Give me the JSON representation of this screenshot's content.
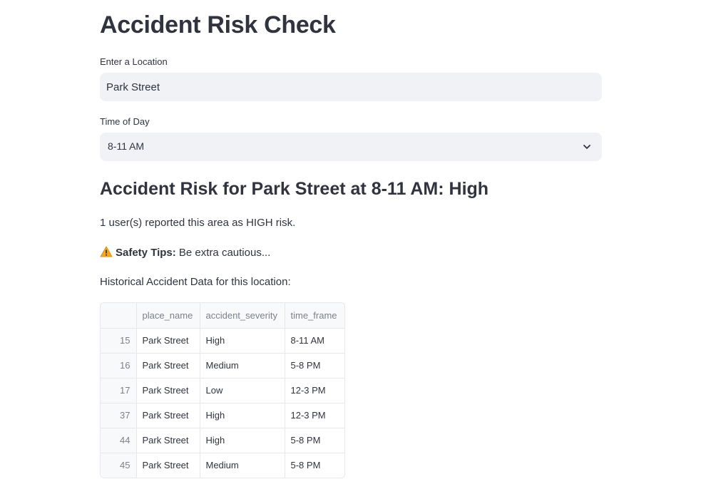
{
  "page": {
    "title": "Accident Risk Check"
  },
  "location": {
    "label": "Enter a Location",
    "value": "Park Street"
  },
  "time_of_day": {
    "label": "Time of Day",
    "selected": "8-11 AM",
    "icon": "chevron-down-icon"
  },
  "result": {
    "heading": "Accident Risk for Park Street at 8-11 AM: High",
    "reports": "1 user(s) reported this area as HIGH risk.",
    "tips_icon": "warning-icon",
    "tips_label": "Safety Tips:",
    "tips_text": " Be extra cautious...",
    "history_caption": "Historical Accident Data for this location:"
  },
  "table": {
    "columns": [
      "",
      "place_name",
      "accident_severity",
      "time_frame"
    ],
    "rows": [
      {
        "index": "15",
        "place_name": "Park Street",
        "accident_severity": "High",
        "time_frame": "8-11 AM"
      },
      {
        "index": "16",
        "place_name": "Park Street",
        "accident_severity": "Medium",
        "time_frame": "5-8 PM"
      },
      {
        "index": "17",
        "place_name": "Park Street",
        "accident_severity": "Low",
        "time_frame": "12-3 PM"
      },
      {
        "index": "37",
        "place_name": "Park Street",
        "accident_severity": "High",
        "time_frame": "12-3 PM"
      },
      {
        "index": "44",
        "place_name": "Park Street",
        "accident_severity": "High",
        "time_frame": "5-8 PM"
      },
      {
        "index": "45",
        "place_name": "Park Street",
        "accident_severity": "Medium",
        "time_frame": "5-8 PM"
      }
    ]
  },
  "colors": {
    "text": "#31333f",
    "input_bg": "#f0f2f6",
    "table_border": "#e6e8ee",
    "muted": "#7d808a",
    "warning": "#f5a623"
  }
}
